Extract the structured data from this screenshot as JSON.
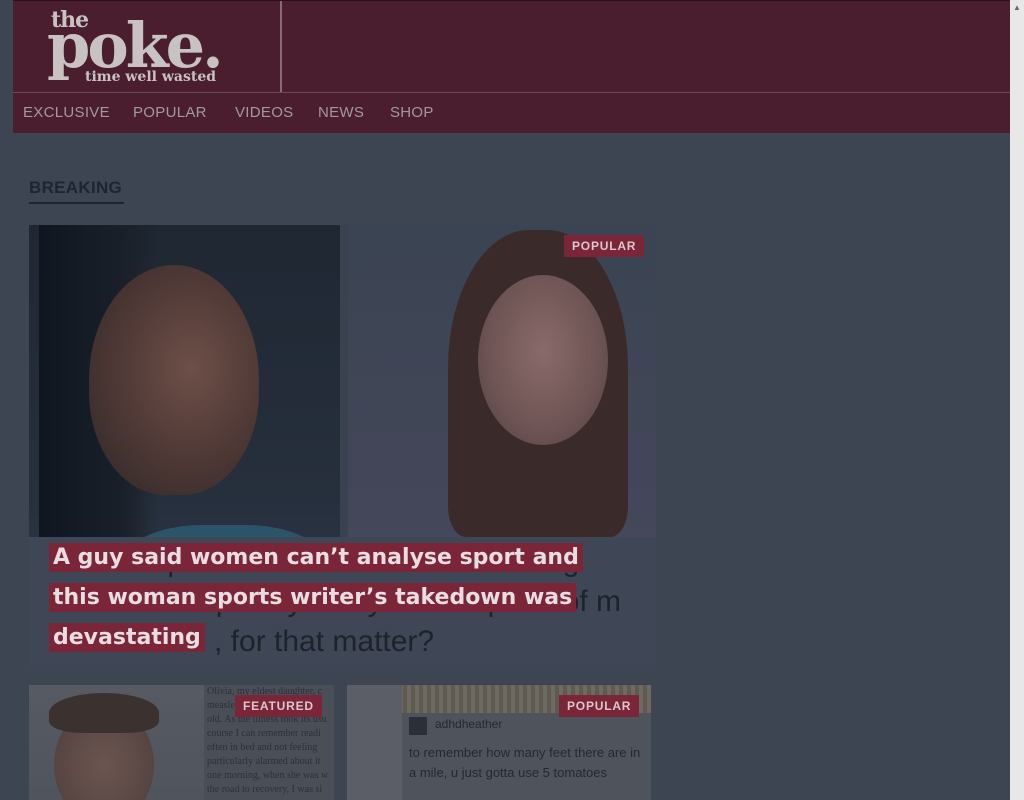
{
  "logo": {
    "the": "the",
    "name": "poke.",
    "tagline": "time well wasted"
  },
  "nav": {
    "items": [
      "EXCLUSIVE",
      "POPULAR",
      "VIDEOS",
      "NEWS",
      "SHOP"
    ]
  },
  "section": {
    "title": "BREAKING"
  },
  "hero": {
    "badge": "POPULAR",
    "headline": "A guy said women can’t analyse sport and this woman sports writer’s takedown was devastating",
    "tweet_lines": [
      "At what point did women start believing",
      "I could adequately analyse the sports of m",
      ", for that matter?"
    ]
  },
  "cards": [
    {
      "badge": "FEATURED",
      "text_lines": [
        "Olivia, my eldest daughter, c",
        "measles when she was seven",
        "old. As the illness took its usu",
        "course I can remember readi",
        "often in bed and not feeling",
        "particularly alarmed about it",
        "one morning, when she was w",
        "the road to recovery, I was si"
      ]
    },
    {
      "badge": "POPULAR",
      "tweet_user": "adhdheather",
      "tweet_text": "to remember how many feet there are in a mile, u just gotta use 5 tomatoes"
    }
  ],
  "colors": {
    "brand": "#4a1e2e",
    "accent": "#7a2538",
    "overlay_bg": "#3d4452"
  }
}
